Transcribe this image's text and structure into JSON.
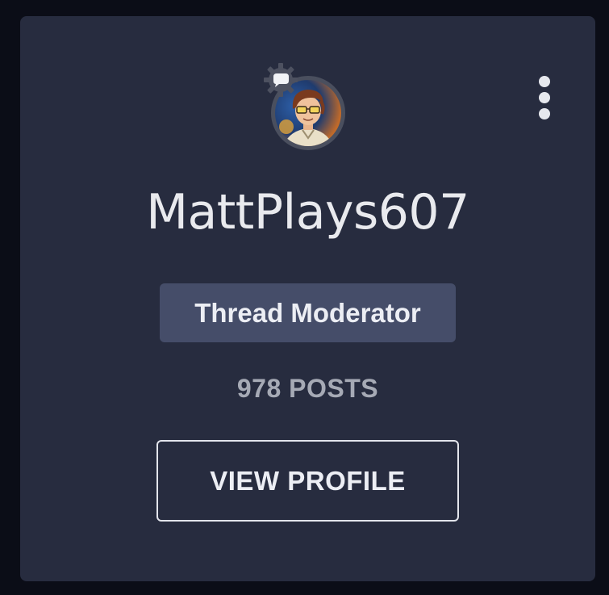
{
  "profile": {
    "username": "MattPlays607",
    "role": "Thread Moderator",
    "posts": "978 POSTS",
    "view_profile_label": "VIEW PROFILE"
  },
  "icons": {
    "avatar": "user-avatar-illustration",
    "badge": "chat-bubble-gear-badge-icon",
    "menu": "more-vertical-icon"
  },
  "colors": {
    "background": "#0b0d17",
    "card": "#272c3f",
    "pill": "#454d69",
    "text": "#e9eaee",
    "muted": "#a6aab5"
  }
}
